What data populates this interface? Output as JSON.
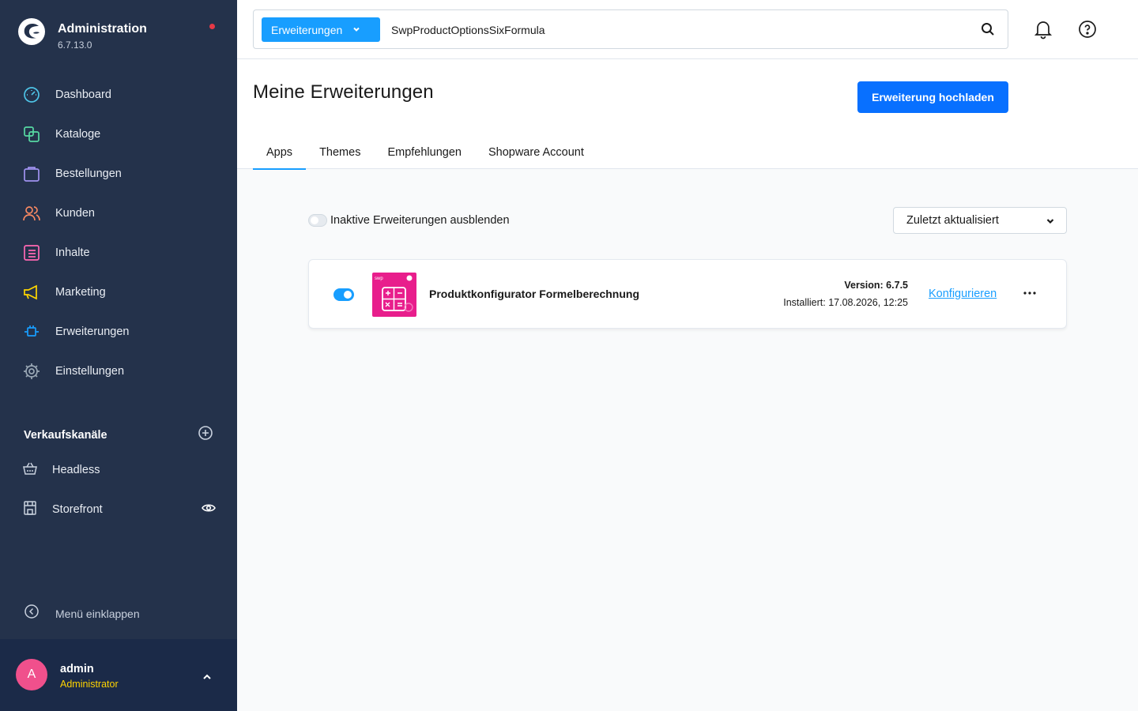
{
  "brand": {
    "title": "Administration",
    "version": "6.7.13.0"
  },
  "nav": [
    {
      "label": "Dashboard",
      "icon": "dashboard-icon",
      "color": "#4ec3e6"
    },
    {
      "label": "Kataloge",
      "icon": "catalog-icon",
      "color": "#57d9a3"
    },
    {
      "label": "Bestellungen",
      "icon": "orders-icon",
      "color": "#a092f0"
    },
    {
      "label": "Kunden",
      "icon": "customers-icon",
      "color": "#f88962"
    },
    {
      "label": "Inhalte",
      "icon": "content-icon",
      "color": "#ff68b4"
    },
    {
      "label": "Marketing",
      "icon": "marketing-icon",
      "color": "#ffd700"
    },
    {
      "label": "Erweiterungen",
      "icon": "extensions-icon",
      "color": "#189eff"
    },
    {
      "label": "Einstellungen",
      "icon": "settings-icon",
      "color": "#9aa8b5"
    }
  ],
  "sales_channels": {
    "title": "Verkaufskanäle",
    "items": [
      {
        "label": "Headless"
      },
      {
        "label": "Storefront"
      }
    ]
  },
  "collapse_label": "Menü einklappen",
  "user": {
    "initial": "A",
    "name": "admin",
    "role": "Administrator"
  },
  "search": {
    "type_label": "Erweiterungen",
    "value": "SwpProductOptionsSixFormula"
  },
  "page": {
    "title": "Meine Erweiterungen",
    "upload_label": "Erweiterung hochladen",
    "tabs": [
      {
        "label": "Apps",
        "active": true
      },
      {
        "label": "Themes",
        "active": false
      },
      {
        "label": "Empfehlungen",
        "active": false
      },
      {
        "label": "Shopware Account",
        "active": false
      }
    ]
  },
  "filter": {
    "toggle_label": "Inaktive Erweiterungen ausblenden",
    "sort_value": "Zuletzt aktualisiert"
  },
  "extension": {
    "name": "Produktkonfigurator Formelberechnung",
    "version": "Version: 6.7.5",
    "installed": "Installiert: 17.08.2026, 12:25",
    "configure_label": "Konfigurieren",
    "icon_text": "swp",
    "active": true
  },
  "colors": {
    "sidebar": "#24324b",
    "accent": "#189eff",
    "primary_button": "#0870ff"
  }
}
